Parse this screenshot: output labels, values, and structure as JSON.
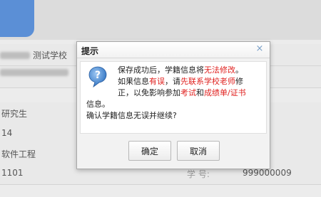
{
  "background": {
    "school_text": "测试学校",
    "education_level": "研究生",
    "row2_value": "14",
    "major": "软件工程",
    "code_value": "1101",
    "student_id_label": "学 号:",
    "student_id_value": "999000009"
  },
  "dialog": {
    "title": "提示",
    "close_icon": "×",
    "message": {
      "line1_a": "保存成功后，学籍信息将",
      "line1_red": "无法修改",
      "line1_b": "。",
      "line2_a": "如果信息",
      "line2_red1": "有误",
      "line2_b": "，请",
      "line2_red2": "先联系学校老师",
      "line2_c": "修",
      "line3_a": "正，以免影响参加",
      "line3_red1": "考试",
      "line3_b": "和",
      "line3_red2": "成绩单/证书",
      "line4": "信息。",
      "line5": "确认学籍信息无误并继续?"
    },
    "buttons": {
      "confirm": "确定",
      "cancel": "取消"
    }
  },
  "colors": {
    "accent_red": "#e0211f",
    "tab_blue": "#5b8fd6"
  }
}
